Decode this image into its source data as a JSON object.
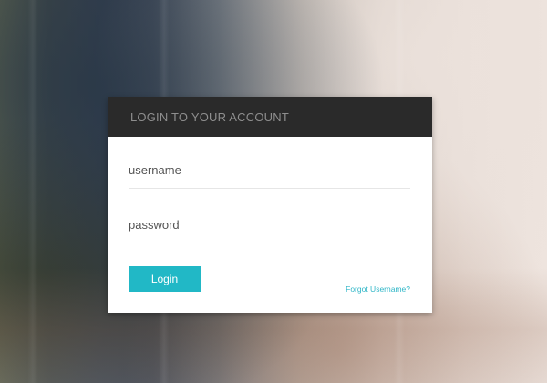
{
  "login": {
    "title": "LOGIN TO YOUR ACCOUNT",
    "username": {
      "placeholder": "username",
      "value": ""
    },
    "password": {
      "placeholder": "password",
      "value": ""
    },
    "submit_label": "Login",
    "forgot_label": "Forgot Username?"
  },
  "colors": {
    "accent": "#21b8c6",
    "header": "#2a2a2a",
    "link": "#2fb6c7"
  }
}
